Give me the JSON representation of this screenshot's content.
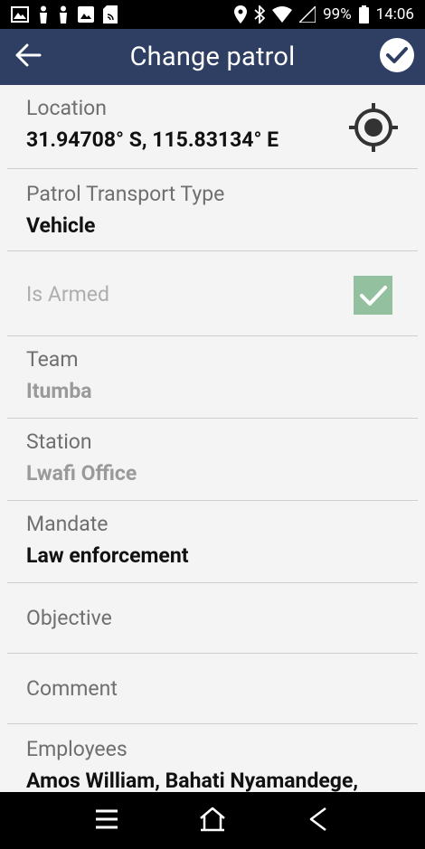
{
  "status_bar": {
    "battery": "99%",
    "time": "14:06"
  },
  "app_bar": {
    "title": "Change patrol",
    "back_icon": "arrow-left-icon",
    "confirm_icon": "check-circle-icon"
  },
  "form": {
    "location": {
      "label": "Location",
      "value": "31.94708° S, 115.83134° E"
    },
    "transport": {
      "label": "Patrol Transport Type",
      "value": "Vehicle"
    },
    "armed": {
      "label": "Is Armed",
      "checked": true
    },
    "team": {
      "label": "Team",
      "value": "Itumba"
    },
    "station": {
      "label": "Station",
      "value": "Lwafi Office"
    },
    "mandate": {
      "label": "Mandate",
      "value": "Law enforcement"
    },
    "objective": {
      "label": "Objective"
    },
    "comment": {
      "label": "Comment"
    },
    "employees": {
      "label": "Employees",
      "value": "Amos William, Bahati Nyamandege,"
    }
  },
  "colors": {
    "app_bar": "#2e3f63",
    "checkbox": "#93c19f",
    "background": "#f4f4f4"
  }
}
